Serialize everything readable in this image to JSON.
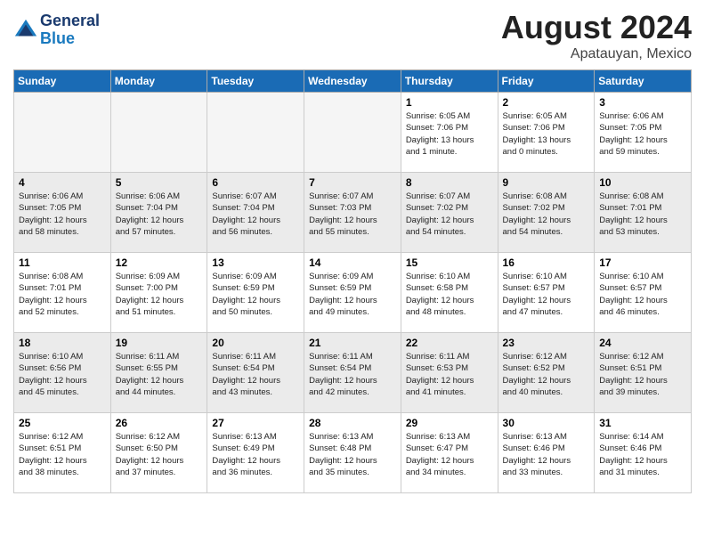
{
  "header": {
    "logo_line1": "General",
    "logo_line2": "Blue",
    "month_year": "August 2024",
    "location": "Apatauyan, Mexico"
  },
  "weekdays": [
    "Sunday",
    "Monday",
    "Tuesday",
    "Wednesday",
    "Thursday",
    "Friday",
    "Saturday"
  ],
  "weeks": [
    [
      {
        "day": "",
        "info": ""
      },
      {
        "day": "",
        "info": ""
      },
      {
        "day": "",
        "info": ""
      },
      {
        "day": "",
        "info": ""
      },
      {
        "day": "1",
        "info": "Sunrise: 6:05 AM\nSunset: 7:06 PM\nDaylight: 13 hours\nand 1 minute."
      },
      {
        "day": "2",
        "info": "Sunrise: 6:05 AM\nSunset: 7:06 PM\nDaylight: 13 hours\nand 0 minutes."
      },
      {
        "day": "3",
        "info": "Sunrise: 6:06 AM\nSunset: 7:05 PM\nDaylight: 12 hours\nand 59 minutes."
      }
    ],
    [
      {
        "day": "4",
        "info": "Sunrise: 6:06 AM\nSunset: 7:05 PM\nDaylight: 12 hours\nand 58 minutes."
      },
      {
        "day": "5",
        "info": "Sunrise: 6:06 AM\nSunset: 7:04 PM\nDaylight: 12 hours\nand 57 minutes."
      },
      {
        "day": "6",
        "info": "Sunrise: 6:07 AM\nSunset: 7:04 PM\nDaylight: 12 hours\nand 56 minutes."
      },
      {
        "day": "7",
        "info": "Sunrise: 6:07 AM\nSunset: 7:03 PM\nDaylight: 12 hours\nand 55 minutes."
      },
      {
        "day": "8",
        "info": "Sunrise: 6:07 AM\nSunset: 7:02 PM\nDaylight: 12 hours\nand 54 minutes."
      },
      {
        "day": "9",
        "info": "Sunrise: 6:08 AM\nSunset: 7:02 PM\nDaylight: 12 hours\nand 54 minutes."
      },
      {
        "day": "10",
        "info": "Sunrise: 6:08 AM\nSunset: 7:01 PM\nDaylight: 12 hours\nand 53 minutes."
      }
    ],
    [
      {
        "day": "11",
        "info": "Sunrise: 6:08 AM\nSunset: 7:01 PM\nDaylight: 12 hours\nand 52 minutes."
      },
      {
        "day": "12",
        "info": "Sunrise: 6:09 AM\nSunset: 7:00 PM\nDaylight: 12 hours\nand 51 minutes."
      },
      {
        "day": "13",
        "info": "Sunrise: 6:09 AM\nSunset: 6:59 PM\nDaylight: 12 hours\nand 50 minutes."
      },
      {
        "day": "14",
        "info": "Sunrise: 6:09 AM\nSunset: 6:59 PM\nDaylight: 12 hours\nand 49 minutes."
      },
      {
        "day": "15",
        "info": "Sunrise: 6:10 AM\nSunset: 6:58 PM\nDaylight: 12 hours\nand 48 minutes."
      },
      {
        "day": "16",
        "info": "Sunrise: 6:10 AM\nSunset: 6:57 PM\nDaylight: 12 hours\nand 47 minutes."
      },
      {
        "day": "17",
        "info": "Sunrise: 6:10 AM\nSunset: 6:57 PM\nDaylight: 12 hours\nand 46 minutes."
      }
    ],
    [
      {
        "day": "18",
        "info": "Sunrise: 6:10 AM\nSunset: 6:56 PM\nDaylight: 12 hours\nand 45 minutes."
      },
      {
        "day": "19",
        "info": "Sunrise: 6:11 AM\nSunset: 6:55 PM\nDaylight: 12 hours\nand 44 minutes."
      },
      {
        "day": "20",
        "info": "Sunrise: 6:11 AM\nSunset: 6:54 PM\nDaylight: 12 hours\nand 43 minutes."
      },
      {
        "day": "21",
        "info": "Sunrise: 6:11 AM\nSunset: 6:54 PM\nDaylight: 12 hours\nand 42 minutes."
      },
      {
        "day": "22",
        "info": "Sunrise: 6:11 AM\nSunset: 6:53 PM\nDaylight: 12 hours\nand 41 minutes."
      },
      {
        "day": "23",
        "info": "Sunrise: 6:12 AM\nSunset: 6:52 PM\nDaylight: 12 hours\nand 40 minutes."
      },
      {
        "day": "24",
        "info": "Sunrise: 6:12 AM\nSunset: 6:51 PM\nDaylight: 12 hours\nand 39 minutes."
      }
    ],
    [
      {
        "day": "25",
        "info": "Sunrise: 6:12 AM\nSunset: 6:51 PM\nDaylight: 12 hours\nand 38 minutes."
      },
      {
        "day": "26",
        "info": "Sunrise: 6:12 AM\nSunset: 6:50 PM\nDaylight: 12 hours\nand 37 minutes."
      },
      {
        "day": "27",
        "info": "Sunrise: 6:13 AM\nSunset: 6:49 PM\nDaylight: 12 hours\nand 36 minutes."
      },
      {
        "day": "28",
        "info": "Sunrise: 6:13 AM\nSunset: 6:48 PM\nDaylight: 12 hours\nand 35 minutes."
      },
      {
        "day": "29",
        "info": "Sunrise: 6:13 AM\nSunset: 6:47 PM\nDaylight: 12 hours\nand 34 minutes."
      },
      {
        "day": "30",
        "info": "Sunrise: 6:13 AM\nSunset: 6:46 PM\nDaylight: 12 hours\nand 33 minutes."
      },
      {
        "day": "31",
        "info": "Sunrise: 6:14 AM\nSunset: 6:46 PM\nDaylight: 12 hours\nand 31 minutes."
      }
    ]
  ]
}
